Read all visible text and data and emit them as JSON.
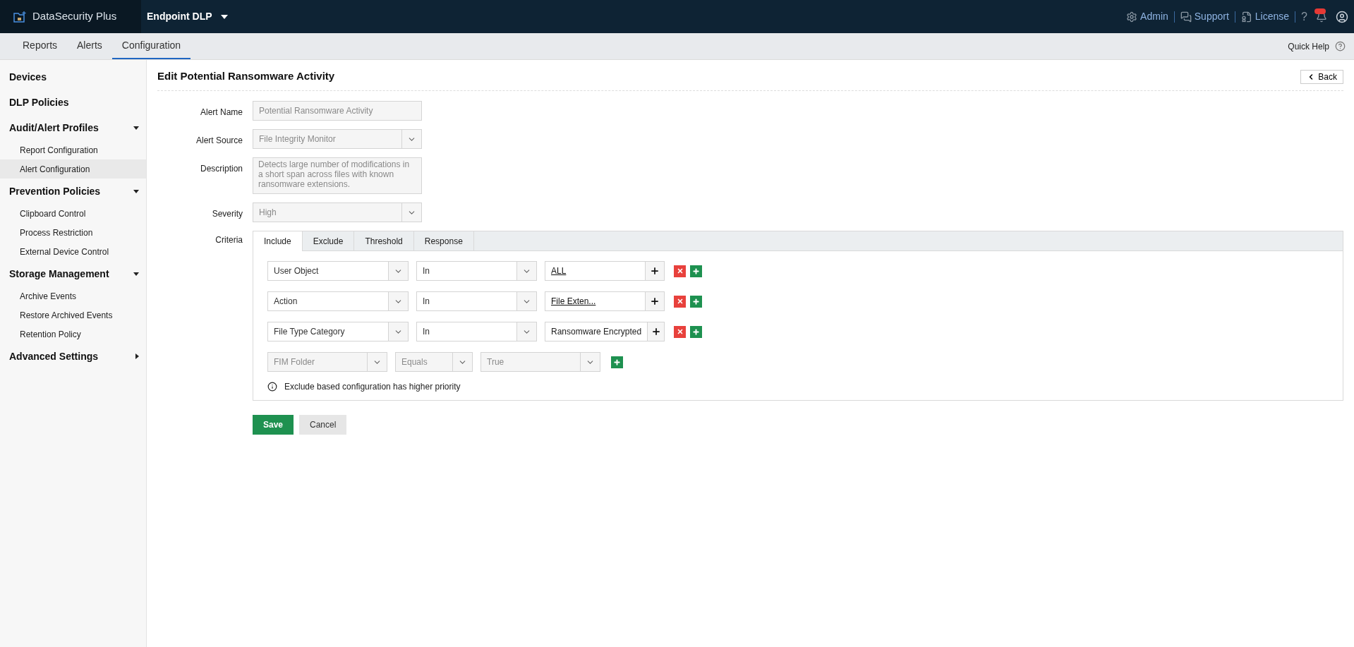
{
  "header": {
    "brand": "DataSecurity Plus",
    "product": "Endpoint DLP",
    "links": [
      {
        "label": "Admin",
        "kind": "admin"
      },
      {
        "label": "Support",
        "kind": "support"
      },
      {
        "label": "License",
        "kind": "license"
      }
    ],
    "help": "?"
  },
  "tabs": [
    {
      "label": "Reports",
      "selected": false
    },
    {
      "label": "Alerts",
      "selected": false
    },
    {
      "label": "Configuration",
      "selected": true
    }
  ],
  "quick_help": "Quick Help",
  "sidebar": {
    "items": [
      {
        "label": "Devices",
        "selected": false
      },
      {
        "label": "DLP Policies",
        "selected": false
      },
      {
        "label": "Audit/Alert Profiles",
        "expanded": true,
        "selected": false,
        "children": [
          {
            "label": "Report Configuration",
            "selected": false
          },
          {
            "label": "Alert Configuration",
            "selected": true
          }
        ]
      },
      {
        "label": "Prevention Policies",
        "expanded": true,
        "selected": false,
        "children": [
          {
            "label": "Clipboard Control",
            "selected": false
          },
          {
            "label": "Process Restriction",
            "selected": false
          },
          {
            "label": "External Device Control",
            "selected": false
          }
        ]
      },
      {
        "label": "Storage Management",
        "expanded": true,
        "selected": false,
        "children": [
          {
            "label": "Archive Events",
            "selected": false
          },
          {
            "label": "Restore Archived Events",
            "selected": false
          },
          {
            "label": "Retention Policy",
            "selected": false
          }
        ]
      },
      {
        "label": "Advanced Settings",
        "expanded": false,
        "selected": false
      }
    ]
  },
  "page": {
    "title": "Edit Potential Ransomware Activity",
    "back": "Back"
  },
  "form": [
    {
      "label": "Alert Name",
      "kind": "text",
      "value": "Potential Ransomware Activity",
      "disabled": true
    },
    {
      "label": "Alert Source",
      "kind": "select",
      "value": "File Integrity Monitor",
      "disabled": true
    },
    {
      "label": "Description",
      "kind": "textarea",
      "value": "Detects large number of modifications in a short span across files with known ransomware extensions.",
      "disabled": true
    },
    {
      "label": "Severity",
      "kind": "select",
      "value": "High",
      "disabled": true
    }
  ],
  "criteria": {
    "label": "Criteria",
    "tabs": [
      {
        "label": "Include",
        "selected": true
      },
      {
        "label": "Exclude",
        "selected": false
      },
      {
        "label": "Threshold",
        "selected": false
      },
      {
        "label": "Response",
        "selected": false
      }
    ],
    "rows": [
      {
        "field": "User Object",
        "operator": "In",
        "value": "ALL",
        "kind": "picker",
        "link": true,
        "disabled": false
      },
      {
        "field": "Action",
        "operator": "In",
        "value": "File Exten...",
        "kind": "picker",
        "link": true,
        "disabled": false
      },
      {
        "field": "File Type Category",
        "operator": "In",
        "value": "Ransomware Encrypted",
        "kind": "picker",
        "link": false,
        "disabled": false
      },
      {
        "field": "FIM Folder",
        "operator": "Equals",
        "value": "True",
        "kind": "select",
        "disabled": true
      }
    ],
    "note": "Exclude based configuration has higher priority"
  },
  "buttons": [
    {
      "label": "Save",
      "kind": "primary"
    },
    {
      "label": "Cancel",
      "kind": "secondary"
    }
  ]
}
